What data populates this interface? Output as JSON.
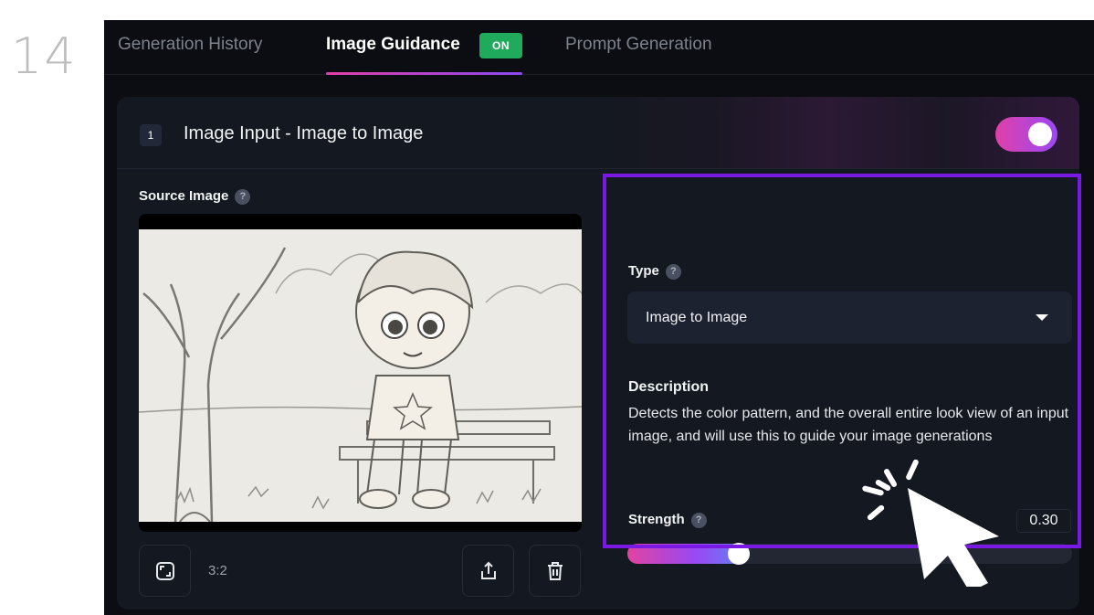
{
  "step_number": "14",
  "tabs": [
    {
      "label": "Generation History",
      "active": false
    },
    {
      "label": "Image Guidance",
      "active": true,
      "badge": "ON"
    },
    {
      "label": "Prompt Generation",
      "active": false
    }
  ],
  "card": {
    "index": "1",
    "title": "Image Input - Image to Image",
    "enabled": true
  },
  "source": {
    "label": "Source Image",
    "help": "?",
    "aspect_ratio": "3:2"
  },
  "settings": {
    "type_label": "Type",
    "type_help": "?",
    "type_value": "Image to Image",
    "description_label": "Description",
    "description_text": "Detects the color pattern, and the overall entire look view of an input image, and will use this to guide your image generations",
    "strength_label": "Strength",
    "strength_help": "?",
    "strength_value": "0.30",
    "strength_fraction": 0.25
  },
  "colors": {
    "accent_pink": "#e040a8",
    "accent_purple": "#9a48f4",
    "on_badge": "#1faa5c",
    "highlight_border": "#7a18e4"
  },
  "icons": [
    "aspect-ratio-icon",
    "share-icon",
    "trash-icon",
    "chevron-down-icon",
    "help-icon",
    "pointer-cursor-icon"
  ]
}
